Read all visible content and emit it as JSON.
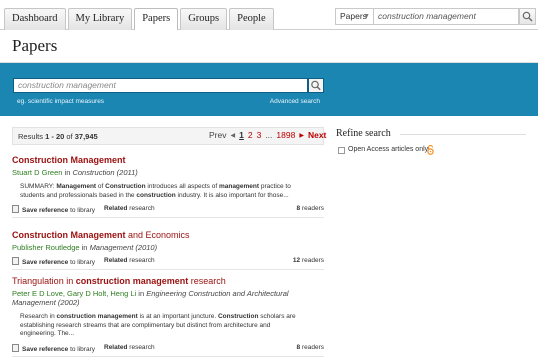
{
  "nav": {
    "tabs": [
      {
        "label": "Dashboard"
      },
      {
        "label": "My Library"
      },
      {
        "label": "Papers"
      },
      {
        "label": "Groups"
      },
      {
        "label": "People"
      }
    ],
    "scope": {
      "value": "Papers"
    },
    "search": {
      "value": "construction management"
    }
  },
  "page": {
    "title": "Papers"
  },
  "search_panel": {
    "placeholder": "construction management",
    "example": "eg. scientific impact measures",
    "advanced": "Advanced search"
  },
  "results_bar": {
    "prefix": "Results",
    "range": "1 - 20",
    "of": "of",
    "total": "37,945",
    "prev": "Prev",
    "pages": [
      "1",
      "2",
      "3",
      "...",
      "1898"
    ],
    "next": "Next"
  },
  "results": [
    {
      "title_parts": [
        {
          "t": "Construction Management",
          "b": true
        }
      ],
      "authors": "Stuart D Green",
      "in": "in",
      "journal": "Construction (2011)",
      "summary_parts": [
        {
          "t": "SUMMARY: ",
          "b": false
        },
        {
          "t": "Management",
          "b": true
        },
        {
          "t": " of ",
          "b": false
        },
        {
          "t": "Construction",
          "b": true
        },
        {
          "t": " introduces all aspects of ",
          "b": false
        },
        {
          "t": "management",
          "b": true
        },
        {
          "t": " practice to students and professionals based in the ",
          "b": false
        },
        {
          "t": "construction",
          "b": true
        },
        {
          "t": " industry. It is also important for those...",
          "b": false
        }
      ],
      "save": "Save reference",
      "save_suffix": "to library",
      "related": "Related",
      "related_suffix": "research",
      "readers": "8",
      "readers_suffix": "readers"
    },
    {
      "title_parts": [
        {
          "t": "Construction Management",
          "b": true
        },
        {
          "t": " and Economics",
          "b": false
        }
      ],
      "authors": "Publisher Routledge",
      "in": "in",
      "journal": "Management (2010)",
      "summary_parts": [],
      "save": "Save reference",
      "save_suffix": "to library",
      "related": "Related",
      "related_suffix": "research",
      "readers": "12",
      "readers_suffix": "readers"
    },
    {
      "title_parts": [
        {
          "t": "Triangulation in ",
          "b": false
        },
        {
          "t": "construction management",
          "b": true
        },
        {
          "t": " research",
          "b": false
        }
      ],
      "authors": "Peter E D Love, Gary D Holt, Heng Li",
      "in": "in",
      "journal": "Engineering Construction and Architectural Management (2002)",
      "summary_parts": [
        {
          "t": "Research in ",
          "b": false
        },
        {
          "t": "construction management",
          "b": true
        },
        {
          "t": " is at an important juncture. ",
          "b": false
        },
        {
          "t": "Construction",
          "b": true
        },
        {
          "t": " scholars are establishing research streams that are complimentary but distinct from architecture and engineering. The...",
          "b": false
        }
      ],
      "save": "Save reference",
      "save_suffix": "to library",
      "related": "Related",
      "related_suffix": "research",
      "readers": "8",
      "readers_suffix": "readers"
    }
  ],
  "refine": {
    "title": "Refine search",
    "open_access": "Open Access articles only"
  },
  "colors": {
    "accent": "#1c86b3",
    "title_red": "#9b1010",
    "author_green": "#2e7d1f",
    "oa_orange": "#f08a1c"
  },
  "icons": [
    "search-icon",
    "dropdown-caret-icon",
    "reference-icon",
    "open-access-icon",
    "prev-arrow-icon",
    "next-arrow-icon"
  ]
}
